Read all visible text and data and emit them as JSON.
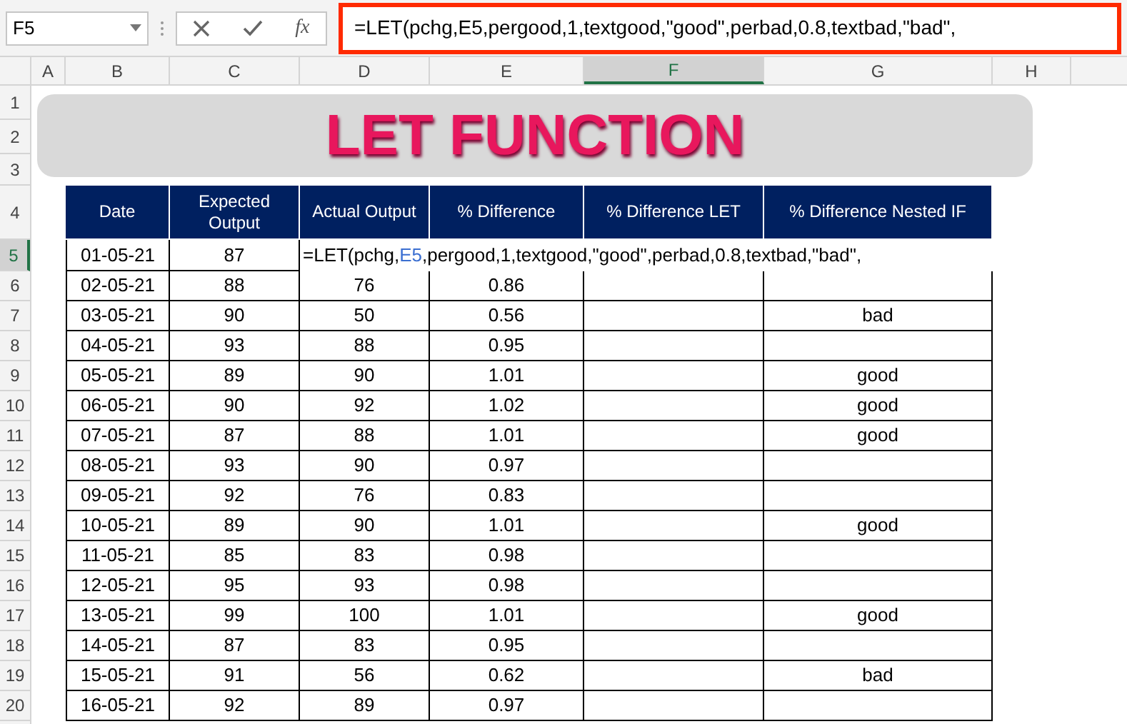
{
  "name_box": "F5",
  "formula_buttons": {
    "function_label": "fx"
  },
  "formula_bar": {
    "value": "=LET(pchg,E5,pergood,1,textgood,\"good\",perbad,0.8,textbad,\"bad\","
  },
  "columns": [
    {
      "label": "A",
      "selected": false
    },
    {
      "label": "B",
      "selected": false
    },
    {
      "label": "C",
      "selected": false
    },
    {
      "label": "D",
      "selected": false
    },
    {
      "label": "E",
      "selected": false
    },
    {
      "label": "F",
      "selected": true
    },
    {
      "label": "G",
      "selected": false
    },
    {
      "label": "H",
      "selected": false
    }
  ],
  "row_numbers": [
    {
      "label": "1",
      "selected": false
    },
    {
      "label": "2",
      "selected": false
    },
    {
      "label": "3",
      "selected": false
    },
    {
      "label": "4",
      "selected": false
    },
    {
      "label": "5",
      "selected": true
    },
    {
      "label": "6",
      "selected": false
    },
    {
      "label": "7",
      "selected": false
    },
    {
      "label": "8",
      "selected": false
    },
    {
      "label": "9",
      "selected": false
    },
    {
      "label": "10",
      "selected": false
    },
    {
      "label": "11",
      "selected": false
    },
    {
      "label": "12",
      "selected": false
    },
    {
      "label": "13",
      "selected": false
    },
    {
      "label": "14",
      "selected": false
    },
    {
      "label": "15",
      "selected": false
    },
    {
      "label": "16",
      "selected": false
    },
    {
      "label": "17",
      "selected": false
    },
    {
      "label": "18",
      "selected": false
    },
    {
      "label": "19",
      "selected": false
    },
    {
      "label": "20",
      "selected": false
    }
  ],
  "banner": {
    "title": "LET FUNCTION"
  },
  "table": {
    "columns": [
      "Date",
      "Expected Output",
      "Actual Output",
      "% Difference",
      "% Difference LET",
      "% Difference Nested IF"
    ],
    "editing_row": {
      "date": "01-05-21",
      "expected": "87",
      "formula": [
        {
          "kind": "text",
          "text": "=LET(pchg,"
        },
        {
          "kind": "ref",
          "text": "E5"
        },
        {
          "kind": "text",
          "text": ",pergood,1,textgood,\"good\",perbad,0.8,textbad,\"bad\","
        }
      ]
    },
    "rows": [
      {
        "date": "02-05-21",
        "expected": "88",
        "actual": "76",
        "difference": "0.86"
      },
      {
        "date": "03-05-21",
        "expected": "90",
        "actual": "50",
        "difference": "0.56",
        "nested_if": "bad"
      },
      {
        "date": "04-05-21",
        "expected": "93",
        "actual": "88",
        "difference": "0.95"
      },
      {
        "date": "05-05-21",
        "expected": "89",
        "actual": "90",
        "difference": "1.01",
        "nested_if": "good"
      },
      {
        "date": "06-05-21",
        "expected": "90",
        "actual": "92",
        "difference": "1.02",
        "nested_if": "good"
      },
      {
        "date": "07-05-21",
        "expected": "87",
        "actual": "88",
        "difference": "1.01",
        "nested_if": "good"
      },
      {
        "date": "08-05-21",
        "expected": "93",
        "actual": "90",
        "difference": "0.97"
      },
      {
        "date": "09-05-21",
        "expected": "92",
        "actual": "76",
        "difference": "0.83"
      },
      {
        "date": "10-05-21",
        "expected": "89",
        "actual": "90",
        "difference": "1.01",
        "nested_if": "good"
      },
      {
        "date": "11-05-21",
        "expected": "85",
        "actual": "83",
        "difference": "0.98"
      },
      {
        "date": "12-05-21",
        "expected": "95",
        "actual": "93",
        "difference": "0.98"
      },
      {
        "date": "13-05-21",
        "expected": "99",
        "actual": "100",
        "difference": "1.01",
        "nested_if": "good"
      },
      {
        "date": "14-05-21",
        "expected": "87",
        "actual": "83",
        "difference": "0.95"
      },
      {
        "date": "15-05-21",
        "expected": "91",
        "actual": "56",
        "difference": "0.62",
        "nested_if": "bad"
      },
      {
        "date": "16-05-21",
        "expected": "92",
        "actual": "89",
        "difference": "0.97"
      }
    ]
  }
}
